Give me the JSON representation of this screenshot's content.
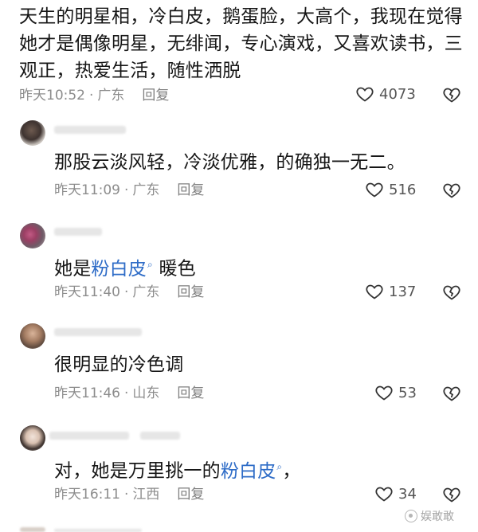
{
  "comments": [
    {
      "lines": [
        "天生的明星相，冷白皮，鹅蛋脸，大高个，我现在觉得",
        "她才是偶像明星，无绯闻，专心演戏，又喜欢读书，三",
        "观正，热爱生活，随性洒脱"
      ],
      "time": "昨天10:52",
      "location": "广东",
      "reply": "回复",
      "likes": "4073"
    },
    {
      "text": "那股云淡风轻，冷淡优雅，的确独一无二。",
      "time": "昨天11:09",
      "location": "广东",
      "reply": "回复",
      "likes": "516"
    },
    {
      "text_before": "她是",
      "link": "粉白皮",
      "text_after": " 暖色",
      "time": "昨天11:40",
      "location": "广东",
      "reply": "回复",
      "likes": "137"
    },
    {
      "text": "很明显的冷色调",
      "time": "昨天11:46",
      "location": "山东",
      "reply": "回复",
      "likes": "53"
    },
    {
      "text_before": "对，她是万里挑一的",
      "link": "粉白皮",
      "text_after": "，",
      "time": "昨天16:11",
      "location": "江西",
      "reply": "回复",
      "likes": "34"
    }
  ],
  "separator": "·",
  "watermark": "娱敢敢",
  "colors": {
    "link": "#2e6cc7",
    "meta": "#8c8c8c",
    "text": "#161616"
  }
}
